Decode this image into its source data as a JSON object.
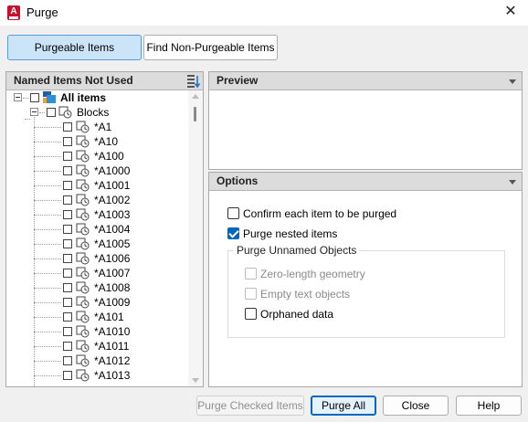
{
  "window": {
    "title": "Purge",
    "close_glyph": "✕",
    "app_icon_letter": "A"
  },
  "mode_tabs": [
    {
      "label": "Purgeable Items",
      "active": true
    },
    {
      "label": "Find Non-Purgeable Items",
      "active": false
    }
  ],
  "left_panel": {
    "title": "Named Items Not Used",
    "root_label": "All items",
    "group_label": "Blocks",
    "items": [
      "*A1",
      "*A10",
      "*A100",
      "*A1000",
      "*A1001",
      "*A1002",
      "*A1003",
      "*A1004",
      "*A1005",
      "*A1006",
      "*A1007",
      "*A1008",
      "*A1009",
      "*A101",
      "*A1010",
      "*A1011",
      "*A1012",
      "*A1013"
    ]
  },
  "preview_panel": {
    "title": "Preview"
  },
  "options_panel": {
    "title": "Options",
    "confirm_each": {
      "label": "Confirm each item to be purged",
      "checked": false
    },
    "purge_nested": {
      "label": "Purge nested items",
      "checked": true
    },
    "unnamed_group": {
      "title": "Purge Unnamed Objects",
      "zero_length": {
        "label": "Zero-length geometry",
        "checked": false,
        "enabled": false
      },
      "empty_text": {
        "label": "Empty text objects",
        "checked": false,
        "enabled": false
      },
      "orphaned": {
        "label": "Orphaned data",
        "checked": false,
        "enabled": true
      }
    }
  },
  "buttons": {
    "purge_checked": "Purge Checked Items",
    "purge_all": "Purge All",
    "close": "Close",
    "help": "Help"
  },
  "colors": {
    "accent": "#0067c0",
    "active_tab": "#cce4f7",
    "app_icon": "#c8102e"
  }
}
